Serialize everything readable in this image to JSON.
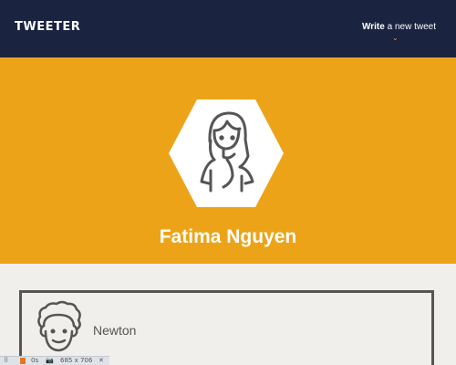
{
  "header": {
    "logo": "TWEETER",
    "write_bold": "Write",
    "write_rest": " a new tweet",
    "caret": "⌄"
  },
  "profile": {
    "name": "Fatima Nguyen"
  },
  "card": {
    "name": "Newton"
  },
  "devtools": {
    "grip": "⠿",
    "timing": "0s",
    "camera": "📷",
    "viewport": "685 x 706",
    "close": "✕"
  },
  "colors": {
    "nav_bg": "#1a2340",
    "hero_bg": "#eda318",
    "page_bg": "#f1efeb",
    "border": "#555555"
  }
}
